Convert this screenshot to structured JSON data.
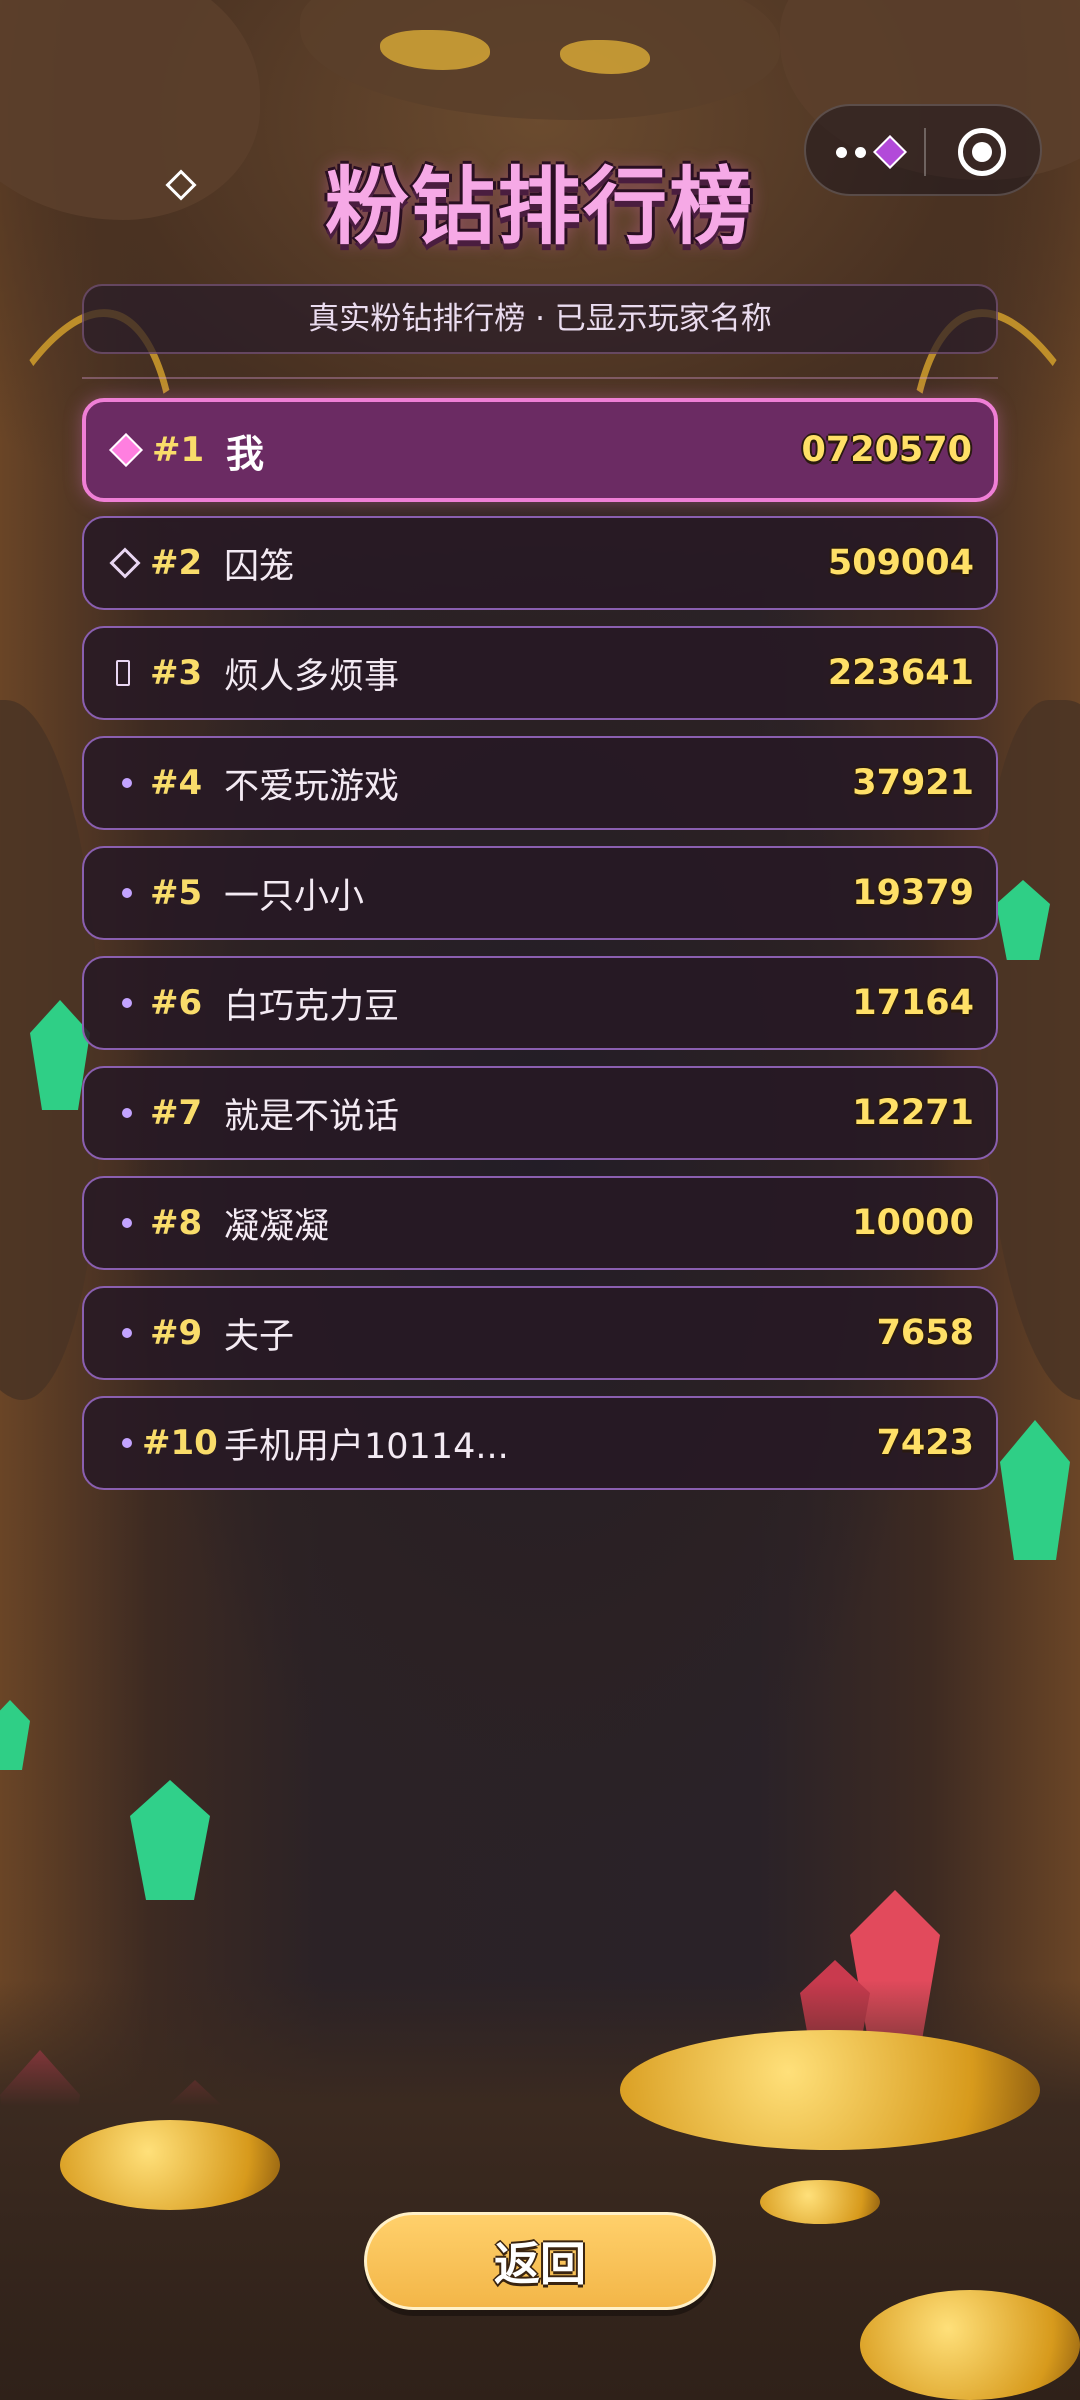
{
  "header": {
    "title": "粉钻排行榜",
    "subtitle": "真实粉钻排行榜 · 已显示玩家名称"
  },
  "leaderboard": {
    "rows": [
      {
        "rank": "#1",
        "name": "我",
        "score": "0720570",
        "marker": "pink-diamond",
        "is_me": true
      },
      {
        "rank": "#2",
        "name": "囚笼",
        "score": "509004",
        "marker": "outline-diamond"
      },
      {
        "rank": "#3",
        "name": "烦人多烦事",
        "score": "223641",
        "marker": "box"
      },
      {
        "rank": "#4",
        "name": "不爱玩游戏",
        "score": "37921",
        "marker": "dot"
      },
      {
        "rank": "#5",
        "name": "一只小小",
        "score": "19379",
        "marker": "dot"
      },
      {
        "rank": "#6",
        "name": "白巧克力豆",
        "score": "17164",
        "marker": "dot"
      },
      {
        "rank": "#7",
        "name": "就是不说话",
        "score": "12271",
        "marker": "dot"
      },
      {
        "rank": "#8",
        "name": "凝凝凝",
        "score": "10000",
        "marker": "dot"
      },
      {
        "rank": "#9",
        "name": "夫子",
        "score": "7658",
        "marker": "dot"
      },
      {
        "rank": "#10",
        "name": "手机用户10114...",
        "score": "7423",
        "marker": "dot"
      }
    ]
  },
  "footer": {
    "back_label": "返回"
  },
  "colors": {
    "title": "#f6a9e6",
    "rank": "#f9dc6a",
    "score": "#ffe067",
    "highlight_row": "#6b2b63",
    "highlight_border": "#ef7fd6",
    "row_border": "#8a5fb0",
    "button": "#f3b648"
  },
  "icons": {
    "title_icon": "diamond-outline-icon",
    "capsule_menu": "more-dots-icon",
    "capsule_close": "target-circle-icon"
  }
}
